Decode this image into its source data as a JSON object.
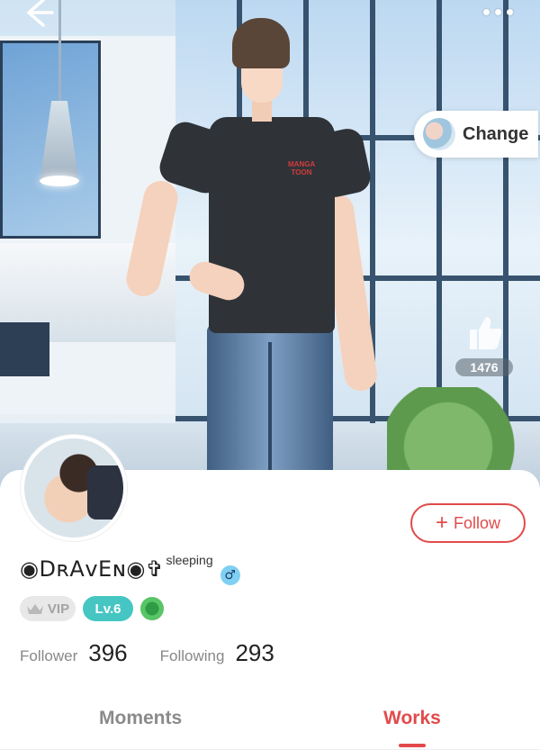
{
  "header": {
    "back_icon": "arrow-left-icon",
    "more_icon": "more-dots-icon"
  },
  "hero": {
    "shirt_logo": "MANGA TOON",
    "change_button": {
      "label": "Change",
      "icon": "character-thumbnail"
    },
    "likes": {
      "icon": "thumbs-up-icon",
      "count": "1476"
    }
  },
  "profile": {
    "name": "◉DʀAᴠEɴ◉✞",
    "status": "sleeping",
    "gender_icon": "male-icon",
    "vip_label": "VIP",
    "level_label": "Lv.6",
    "medal_icon": "medal-icon",
    "follow_button": {
      "label": "Follow",
      "icon": "plus-icon"
    },
    "stats": {
      "follower_label": "Follower",
      "follower_value": "396",
      "following_label": "Following",
      "following_value": "293"
    }
  },
  "tabs": [
    {
      "label": "Moments"
    },
    {
      "label": "Works",
      "active": true
    }
  ],
  "colors": {
    "accent": "#e24a4a",
    "level": "#46c6c3",
    "gender": "#7fd0f2"
  }
}
